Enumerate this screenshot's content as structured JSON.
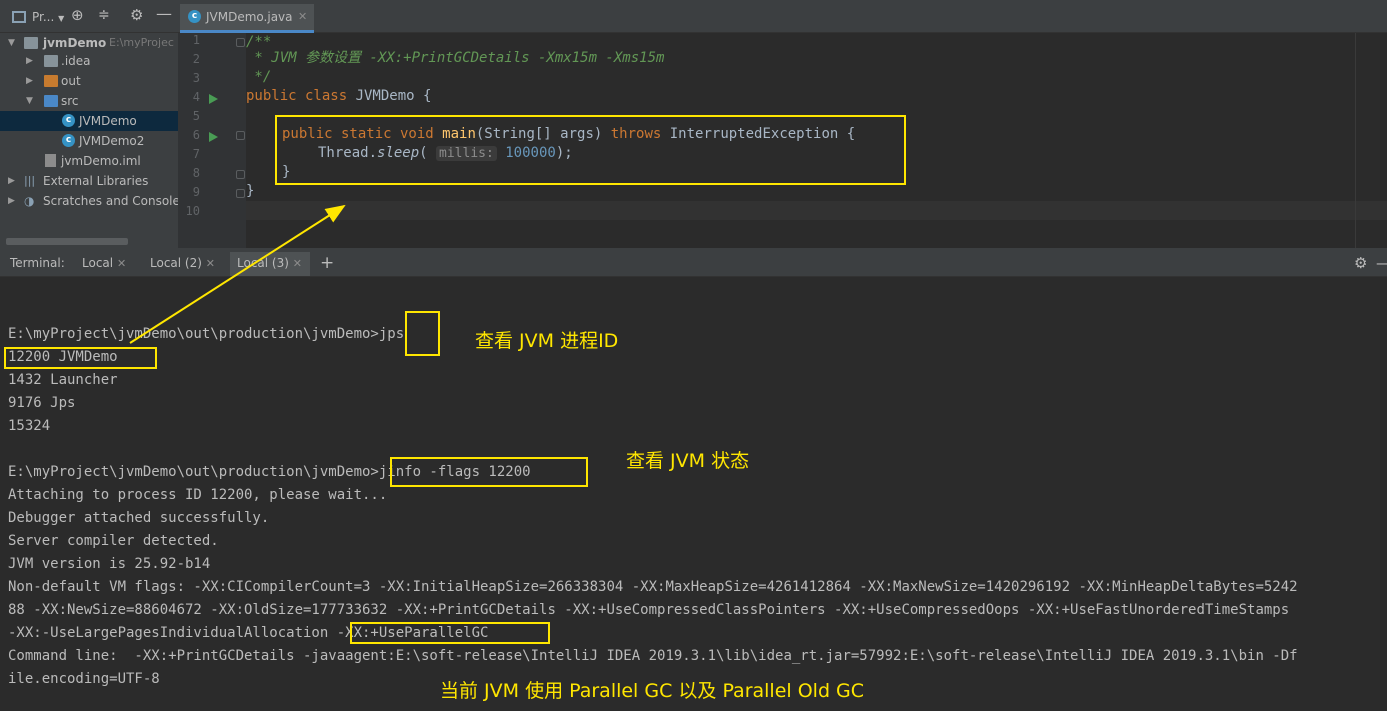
{
  "project_header": {
    "title": "Pr..."
  },
  "tree": [
    {
      "label": "jvmDemo",
      "suffix": "E:\\myProjec",
      "bold": true
    },
    {
      "label": ".idea"
    },
    {
      "label": "out"
    },
    {
      "label": "src"
    },
    {
      "label": "JVMDemo"
    },
    {
      "label": "JVMDemo2"
    },
    {
      "label": "jvmDemo.iml"
    },
    {
      "label": "External Libraries"
    },
    {
      "label": "Scratches and Consoles"
    }
  ],
  "editor": {
    "tab_label": "JVMDemo.java",
    "line_numbers": [
      "1",
      "2",
      "3",
      "4",
      "5",
      "6",
      "7",
      "8",
      "9",
      "10"
    ],
    "code": {
      "l1": "/**",
      "l2": " * JVM 参数设置 -XX:+PrintGCDetails -Xmx15m -Xms15m",
      "l3": " */",
      "l4_kw": "public class ",
      "l4_name": "JVMDemo {",
      "l6_kw1": "public static void ",
      "l6_fn": "main",
      "l6_args": "(String[] args) ",
      "l6_kw2": "throws ",
      "l6_exc": "InterruptedException {",
      "l7_obj": "Thread.",
      "l7_method": "sleep",
      "l7_open": "( ",
      "l7_hint": "millis:",
      "l7_num": " 100000",
      "l7_close": ");",
      "l8": "}",
      "l9": "}"
    }
  },
  "terminal": {
    "label": "Terminal:",
    "tabs": [
      "Local",
      "Local (2)",
      "Local (3)"
    ],
    "lines": [
      "E:\\myProject\\jvmDemo\\out\\production\\jvmDemo>jps",
      "12200 JVMDemo",
      "1432 Launcher",
      "9176 Jps",
      "15324",
      "",
      "E:\\myProject\\jvmDemo\\out\\production\\jvmDemo>jinfo -flags 12200",
      "Attaching to process ID 12200, please wait...",
      "Debugger attached successfully.",
      "Server compiler detected.",
      "JVM version is 25.92-b14",
      "Non-default VM flags: -XX:CICompilerCount=3 -XX:InitialHeapSize=266338304 -XX:MaxHeapSize=4261412864 -XX:MaxNewSize=1420296192 -XX:MinHeapDeltaBytes=5242",
      "88 -XX:NewSize=88604672 -XX:OldSize=177733632 -XX:+PrintGCDetails -XX:+UseCompressedClassPointers -XX:+UseCompressedOops -XX:+UseFastUnorderedTimeStamps",
      "-XX:-UseLargePagesIndividualAllocation -XX:+UseParallelGC",
      "Command line:  -XX:+PrintGCDetails -javaagent:E:\\soft-release\\IntelliJ IDEA 2019.3.1\\lib\\idea_rt.jar=57992:E:\\soft-release\\IntelliJ IDEA 2019.3.1\\bin -Df",
      "ile.encoding=UTF-8"
    ]
  },
  "annotations": {
    "jps_note": "查看 JVM 进程ID",
    "jinfo_note": "查看 JVM 状态",
    "gc_note": "当前 JVM 使用 Parallel GC 以及 Parallel Old GC"
  },
  "colors": {
    "annotation": "#ffe600",
    "background": "#2b2b2b",
    "panel": "#3c3f41"
  }
}
